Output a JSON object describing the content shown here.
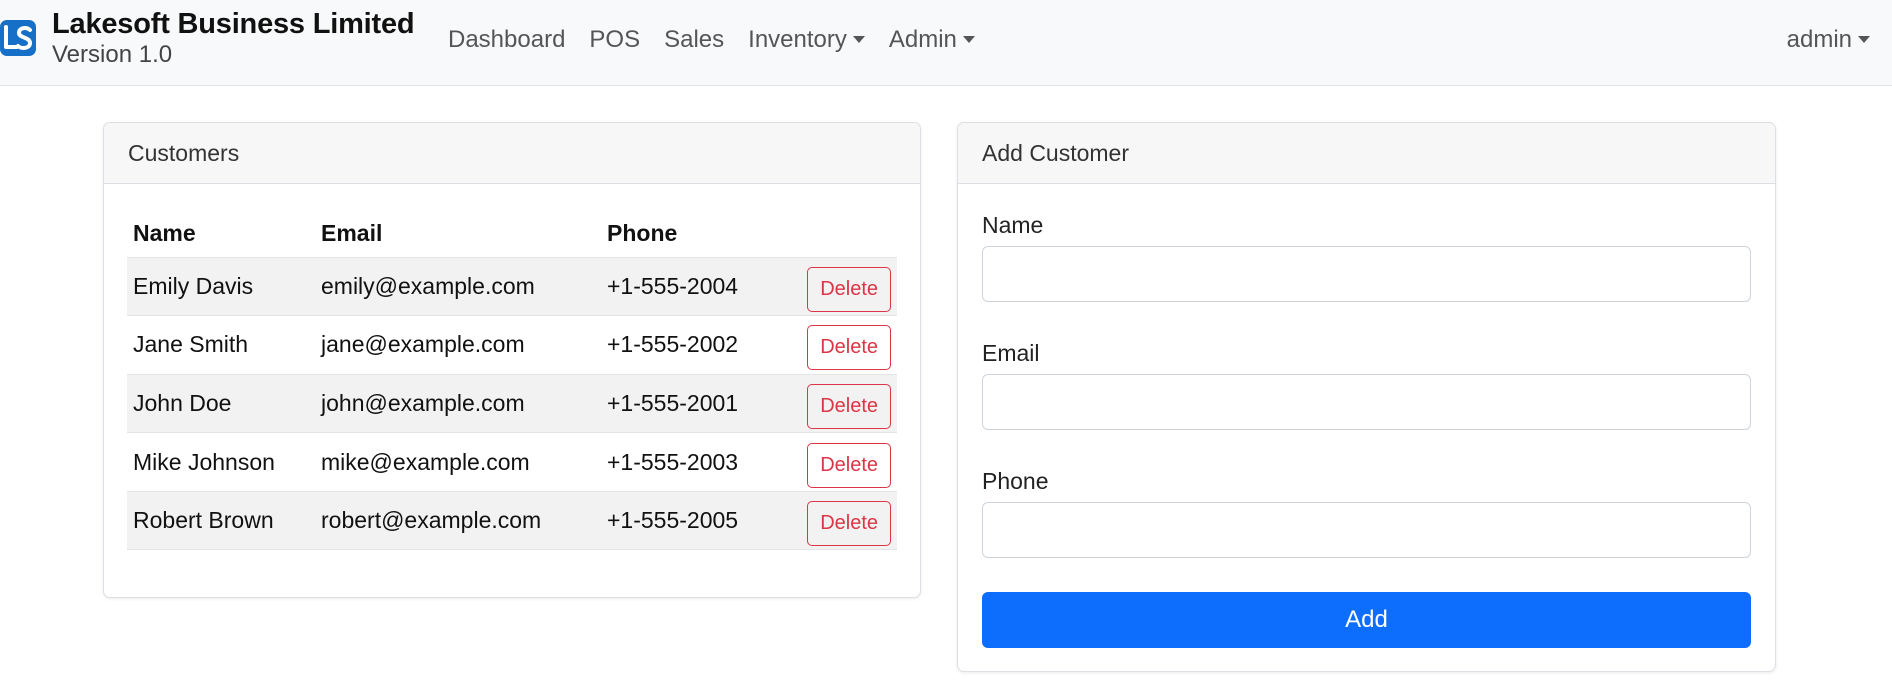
{
  "brand": {
    "name": "Lakesoft Business Limited",
    "version": "Version 1.0",
    "logo_icon": "ls-logo-icon",
    "logo_color": "#1670c7"
  },
  "nav": {
    "items": [
      {
        "label": "Dashboard",
        "dropdown": false
      },
      {
        "label": "POS",
        "dropdown": false
      },
      {
        "label": "Sales",
        "dropdown": false
      },
      {
        "label": "Inventory",
        "dropdown": true
      },
      {
        "label": "Admin",
        "dropdown": true
      }
    ],
    "user": "admin"
  },
  "customers": {
    "title": "Customers",
    "columns": [
      "Name",
      "Email",
      "Phone"
    ],
    "rows": [
      {
        "name": "Emily Davis",
        "email": "emily@example.com",
        "phone": "+1-555-2004",
        "action": "Delete"
      },
      {
        "name": "Jane Smith",
        "email": "jane@example.com",
        "phone": "+1-555-2002",
        "action": "Delete"
      },
      {
        "name": "John Doe",
        "email": "john@example.com",
        "phone": "+1-555-2001",
        "action": "Delete"
      },
      {
        "name": "Mike Johnson",
        "email": "mike@example.com",
        "phone": "+1-555-2003",
        "action": "Delete"
      },
      {
        "name": "Robert Brown",
        "email": "robert@example.com",
        "phone": "+1-555-2005",
        "action": "Delete"
      }
    ]
  },
  "add_customer": {
    "title": "Add Customer",
    "fields": {
      "name": {
        "label": "Name",
        "value": "",
        "placeholder": ""
      },
      "email": {
        "label": "Email",
        "value": "",
        "placeholder": ""
      },
      "phone": {
        "label": "Phone",
        "value": "",
        "placeholder": ""
      }
    },
    "submit_label": "Add"
  },
  "colors": {
    "primary": "#0d6efd",
    "danger": "#dc3545",
    "navbar_bg": "#f8f9fa"
  }
}
